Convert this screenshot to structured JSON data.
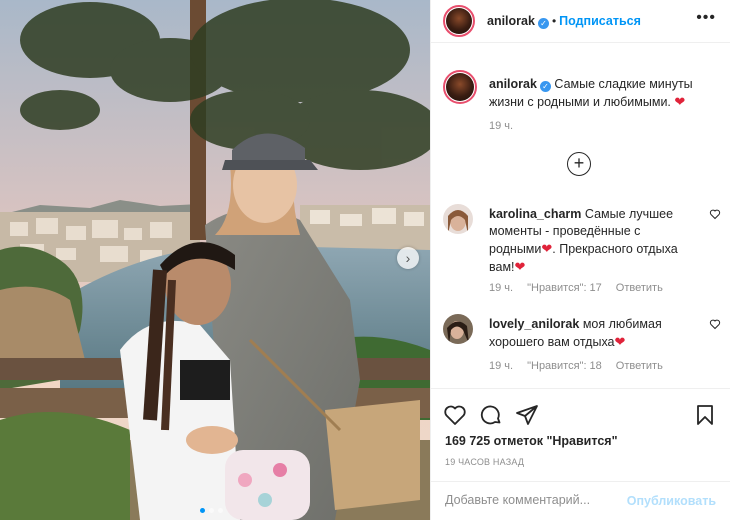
{
  "post": {
    "username": "anilorak",
    "follow_label": "Подписаться",
    "separator": "•",
    "more_icon": "•••",
    "caption_text": "Самые сладкие минуты жизни с родными и любимыми.",
    "caption_time": "19 ч."
  },
  "comments": [
    {
      "username": "karolina_charm",
      "text_parts": [
        "Самые лучшее моменты - проведённые с родными",
        ". Прекрасного отдыха вам!"
      ],
      "time": "19 ч.",
      "likes": "\"Нравится\": 17",
      "reply": "Ответить"
    },
    {
      "username": "lovely_anilorak",
      "text_parts": [
        "моя любимая хорошего вам отдыха"
      ],
      "time": "19 ч.",
      "likes": "\"Нравится\": 18",
      "reply": "Ответить"
    }
  ],
  "stats": {
    "likes": "169 725 отметок \"Нравится\"",
    "ago": "19 ЧАСОВ НАЗАД"
  },
  "add_comment": {
    "placeholder": "Добавьте комментарий...",
    "publish": "Опубликовать"
  },
  "icons": {
    "verified": "verified-badge-icon",
    "heart": "heart-icon",
    "comment": "comment-icon",
    "share": "share-icon",
    "save": "bookmark-icon",
    "next": "chevron-right-icon",
    "plus": "plus-circle-icon"
  },
  "colors": {
    "accent": "#0095f6",
    "verified": "#3897f0",
    "emoji_heart": "#e0233a",
    "muted": "#8e8e8e"
  }
}
